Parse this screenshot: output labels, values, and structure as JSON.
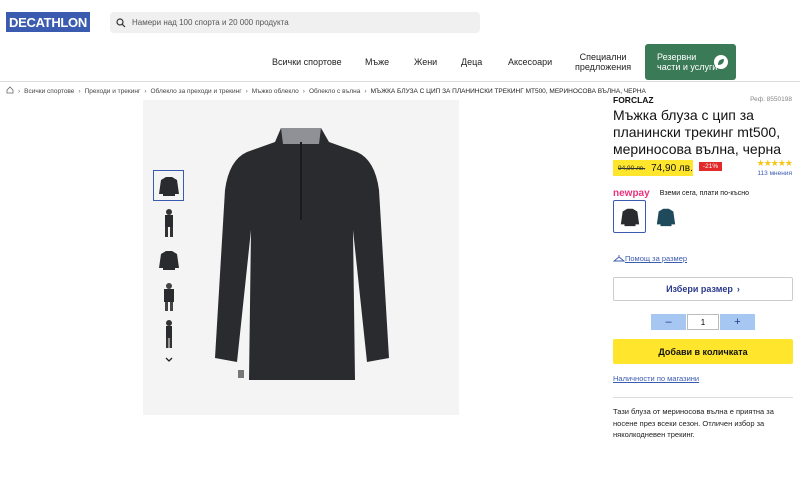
{
  "header": {
    "logo": "DECATHLON",
    "search_placeholder": "Намери над 100 спорта и 20 000 продукта"
  },
  "nav": {
    "items": [
      "Всички спортове",
      "Мъже",
      "Жени",
      "Деца",
      "Аксесоари"
    ],
    "offers_line1": "Специални",
    "offers_line2": "предложения",
    "spare_line1": "Резервни",
    "spare_line2": "части и услуги"
  },
  "breadcrumb": {
    "items": [
      "Всички спортове",
      "Преходи и трекинг",
      "Облекло за преходи и трекинг",
      "Мъжко облекло",
      "Облекло с вълна"
    ],
    "current": "МЪЖКА БЛУЗА С ЦИП ЗА ПЛАНИНСКИ ТРЕКИНГ MT500, МЕРИНОСОВА ВЪЛНА, ЧЕРНА"
  },
  "product": {
    "brand": "FORCLAZ",
    "ref": "Реф. 8550198",
    "title": "Мъжка блуза с цип за планински трекинг mt500, мериносова вълна, черна",
    "old_price": "94,90 лв.",
    "price": "74,90 лв.",
    "discount": "-21%",
    "stars": "★★★★★",
    "reviews": "113 мнения",
    "newpay_logo": "newpay",
    "newpay_text": "Вземи сега, плати по-късно",
    "size_help": "Помощ за размер",
    "size_button": "Избери размер",
    "quantity": "1",
    "add_button": "Добави в количката",
    "availability": "Наличности по магазини",
    "description": "Тази блуза от мериносова вълна е приятна за носене през всеки сезон. Отличен избор за няколкодневен трекинг."
  },
  "colors": {
    "brand_blue": "#3b5bb0",
    "yellow": "#ffe62c",
    "green": "#3b7a57",
    "discount_red": "#e12b2b",
    "newpay_pink": "#e8337d"
  }
}
